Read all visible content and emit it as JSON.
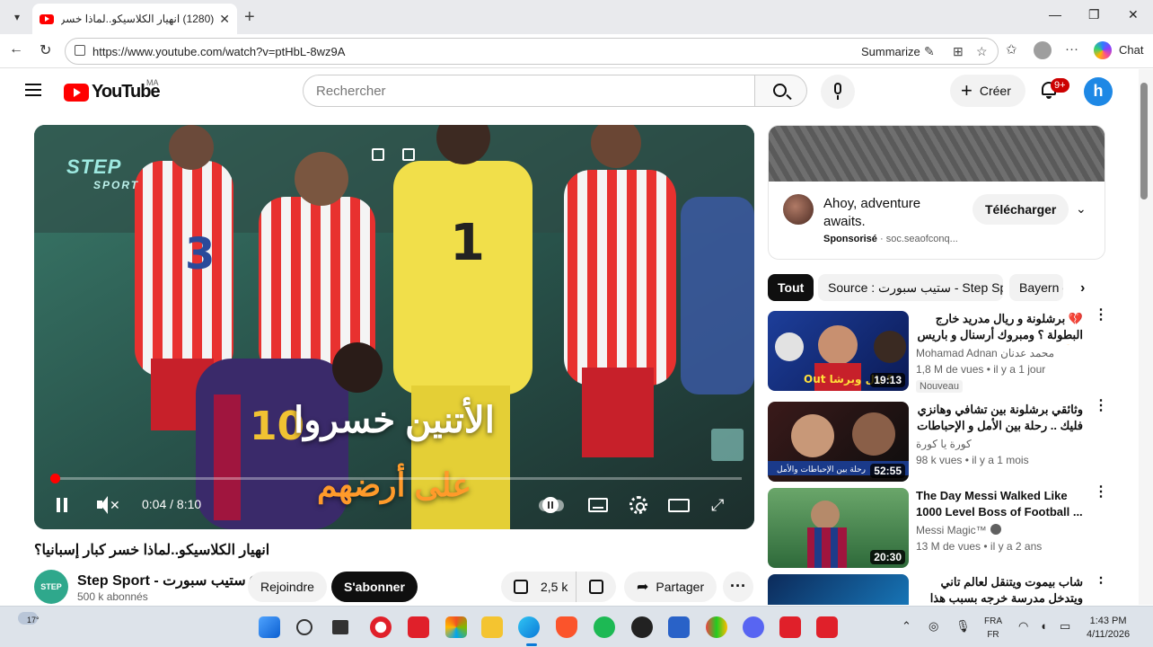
{
  "browser": {
    "tab_title": "(1280) انهيار الكلاسيكو..لماذا خسر ك",
    "url": "https://www.youtube.com/watch?v=ptHbL-8wz9A",
    "summarize_label": "Summarize",
    "chat_label": "Chat",
    "window_controls": {
      "minimize": "—",
      "maximize": "❐",
      "close": "✕"
    }
  },
  "youtube": {
    "logo_text": "YouTube",
    "country_code": "MA",
    "search_placeholder": "Rechercher",
    "create_label": "Créer",
    "notification_count": "9+",
    "avatar_initial": "h"
  },
  "player": {
    "brand_top": "STEP",
    "brand_bottom": "SPORT",
    "overlay_line1": "الأتنين خسروا",
    "overlay_line2": "على أرضهم",
    "time_current": "0:04",
    "time_total": "8:10",
    "time_display": "0:04 / 8:10",
    "progress_fraction": 0.008
  },
  "video": {
    "title": "انهيار الكلاسيكو..لماذا خسر كبار إسبانيا؟",
    "channel_name": "Step Sport - ستيب سبورت",
    "channel_avatar_text": "STEP",
    "subscribers": "500 k abonnés",
    "join_label": "Rejoindre",
    "subscribe_label": "S'abonner",
    "likes": "2,5 k",
    "share_label": "Partager",
    "more_label": "···"
  },
  "ad": {
    "title": "Ahoy, adventure awaits.",
    "sponsored_label": "Sponsorisé",
    "domain": "soc.seaofconq...",
    "cta_label": "Télécharger"
  },
  "chips": [
    "Tout",
    "Source : ستيب سبورت - Step Sport",
    "Bayern d"
  ],
  "recommendations": [
    {
      "title": "💔 برشلونة و ريال مدريد خارج البطولة ؟ ومبروك أرسنال و باريس ! 😎",
      "channel": "Mohamad Adnan محمد عدنان",
      "meta": "1,8 M de vues • il y a 1 jour",
      "badge": "Nouveau",
      "duration": "19:13",
      "thumb_text": "Out ؟ يال وبرشا",
      "rtl": true
    },
    {
      "title": "وثائقي برشلونة بين تشافي وهانزي فليك .. رحلة بين الأمل و الإحباطات المتكررة",
      "channel": "كورة يا كورة",
      "meta": "98 k vues • il y a 1 mois",
      "badge": "",
      "duration": "52:55",
      "thumb_text": "رحلة بين الإحباطات والأمل",
      "rtl": true
    },
    {
      "title": "The Day Messi Walked Like 1000 Level Boss of Football ...",
      "channel": "Messi Magic™",
      "meta": "13 M de vues • il y a 2 ans",
      "badge": "",
      "duration": "20:30",
      "thumb_text": "",
      "rtl": false
    },
    {
      "title": "شاب بيموت ويتنقل لعالم تاني ويتدخل مدرسة خرجه بسبب هذا الشي و...",
      "channel": "",
      "meta": "",
      "badge": "",
      "duration": "",
      "thumb_text": "",
      "rtl": true
    }
  ],
  "taskbar": {
    "temperature": "17°",
    "lang_top": "FRA",
    "lang_bottom": "FR",
    "time": "1:43 PM",
    "date": "4/11/2026"
  },
  "colors": {
    "youtube_red": "#ff0000",
    "subscribe_bg": "#0f0f0f",
    "overlay_orange": "#ff9a2a",
    "brand_teal": "#9de9e0"
  }
}
